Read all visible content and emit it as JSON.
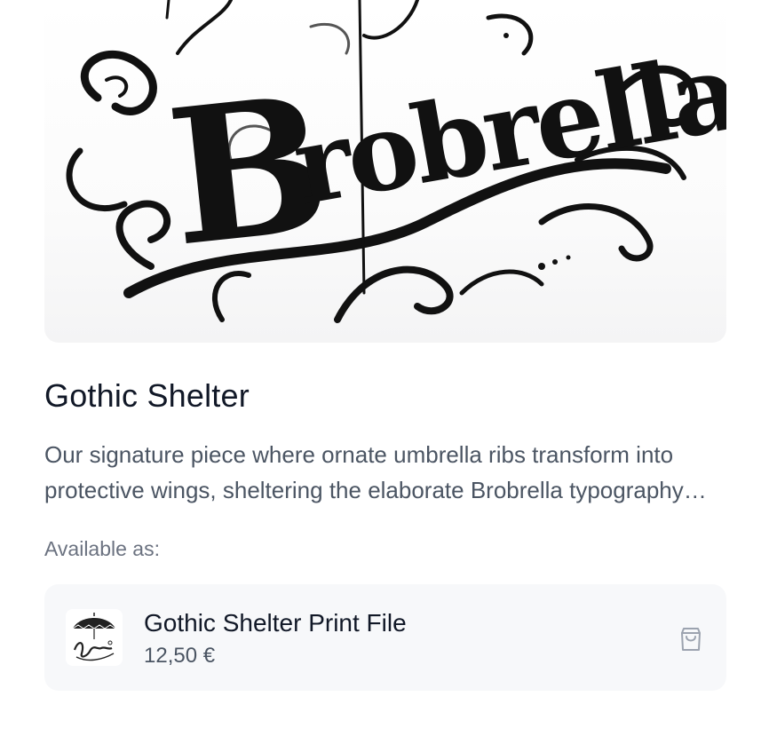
{
  "product": {
    "image_logo_text": "Brobrella",
    "title": "Gothic Shelter",
    "description": "Our signature piece where ornate umbrella ribs transform into protective wings, sheltering the elaborate Brobrella typography beneath them.",
    "available_label": "Available as:"
  },
  "variants": [
    {
      "name": "Gothic Shelter Print File",
      "price": "12,50 €",
      "thumbnail_icon": "umbrella-logo-thumbnail",
      "action_icon": "shopping-bag-icon"
    }
  ],
  "colors": {
    "text_primary": "#111827",
    "text_secondary": "#4b5563",
    "text_muted": "#6b7280",
    "card_background": "#f7f8fa",
    "icon": "#9ca3af"
  }
}
